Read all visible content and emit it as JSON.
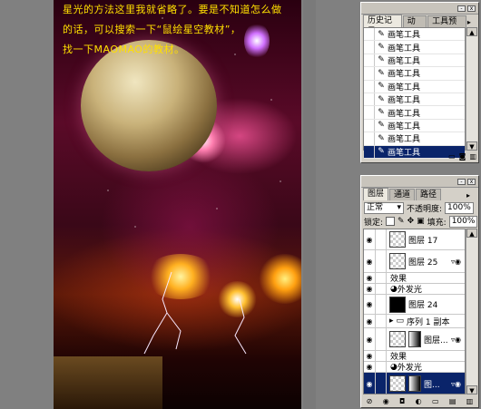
{
  "caption": {
    "line1": "星光的方法这里我就省略了。要是不知道怎么做",
    "line2": "的话，可以搜索一下“鼠绘星空教材”，",
    "line3": "找一下MAOMAO的教材。"
  },
  "history_panel": {
    "tabs": [
      "历史记录",
      "动作",
      "工具预设"
    ],
    "items": [
      "画笔工具",
      "画笔工具",
      "画笔工具",
      "画笔工具",
      "画笔工具",
      "画笔工具",
      "画笔工具",
      "画笔工具",
      "画笔工具",
      "画笔工具"
    ],
    "item_icon": "brush-icon"
  },
  "layers_panel": {
    "tabs": [
      "图层",
      "通道",
      "路径"
    ],
    "blend_mode": "正常",
    "opacity_label": "不透明度:",
    "opacity_value": "100%",
    "lock_label": "锁定:",
    "fill_label": "填充:",
    "fill_value": "100%",
    "layers": [
      {
        "type": "layer",
        "name": "图层 17",
        "thumb": "transparent",
        "fx": false,
        "selected": false
      },
      {
        "type": "layer",
        "name": "图层 25",
        "thumb": "transparent",
        "fx": true,
        "selected": false
      },
      {
        "type": "effect_header",
        "name": "效果"
      },
      {
        "type": "effect",
        "name": "外发光"
      },
      {
        "type": "layer",
        "name": "图层 24",
        "thumb": "black",
        "fx": false,
        "selected": false
      },
      {
        "type": "group",
        "name": "序列 1 副本"
      },
      {
        "type": "layer",
        "name": "图层...",
        "thumb": "transparent",
        "fx": true,
        "selected": false,
        "mask": true
      },
      {
        "type": "effect_header",
        "name": "效果"
      },
      {
        "type": "effect",
        "name": "外发光"
      },
      {
        "type": "layer",
        "name": "图...",
        "thumb": "transparent",
        "fx": true,
        "selected": true,
        "mask": true
      }
    ]
  }
}
